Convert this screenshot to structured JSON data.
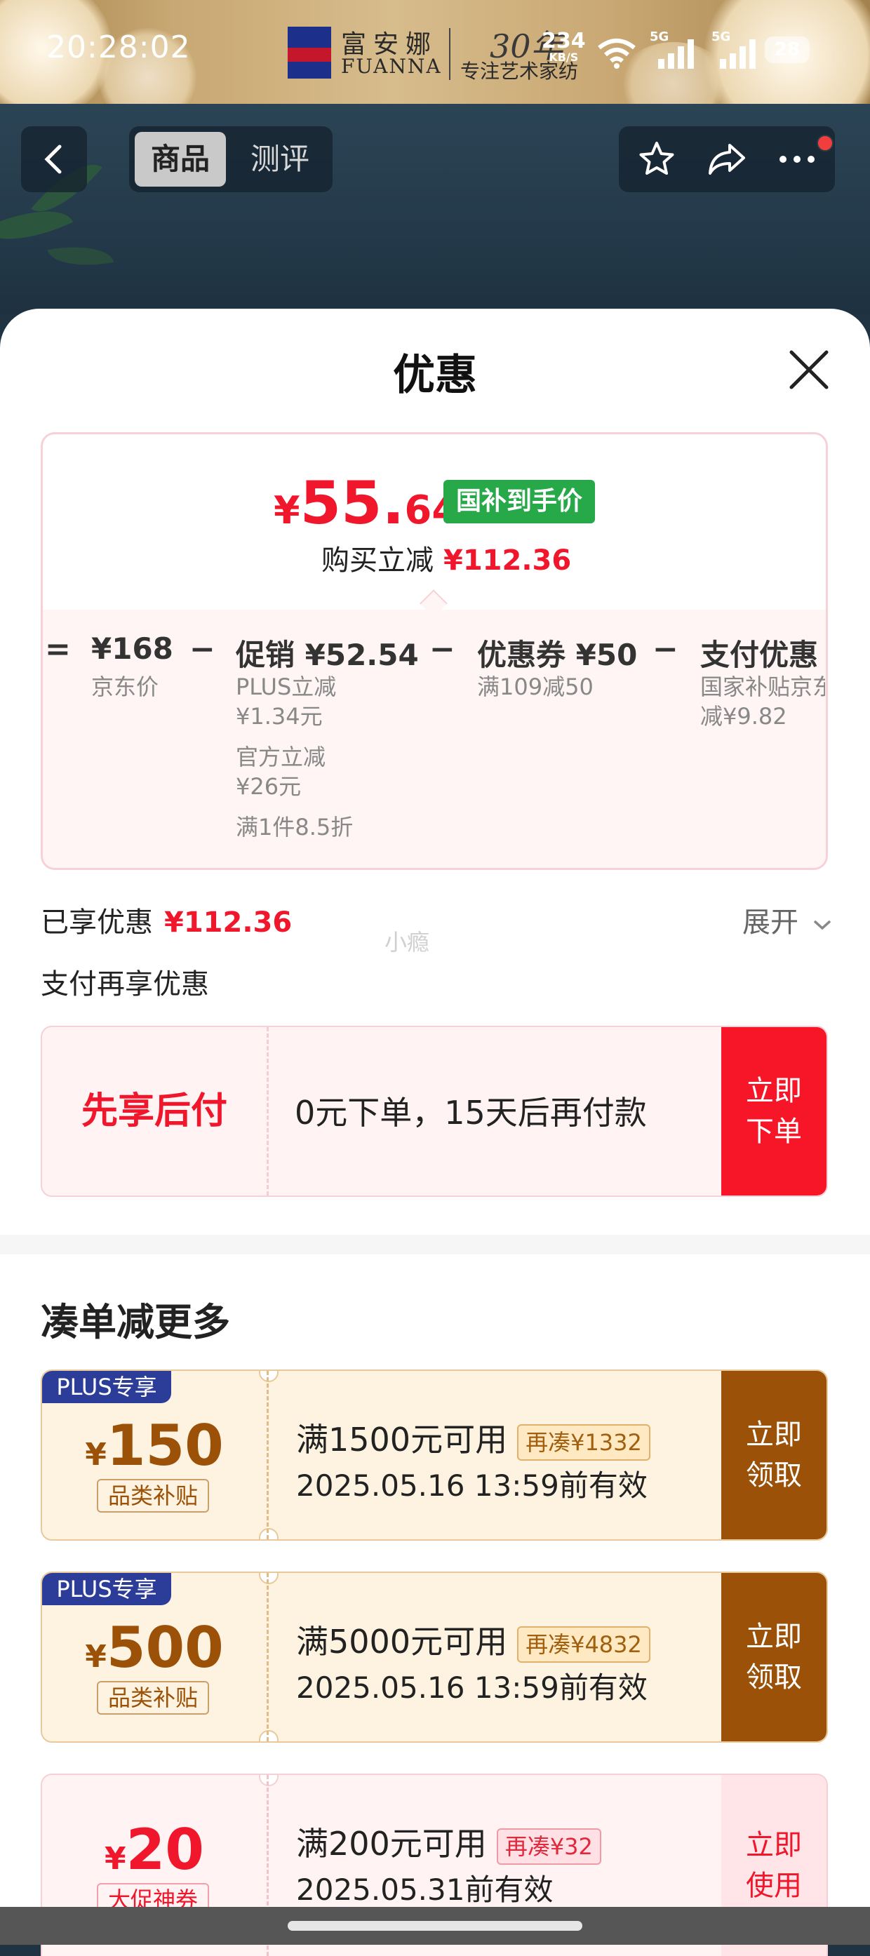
{
  "status_bar": {
    "time": "20:28:02",
    "brand_cn": "富安娜",
    "brand_en": "FUANNA",
    "brand_years": "30年",
    "brand_slogan": "专注艺术家纺",
    "net_speed": "234",
    "net_unit": "KB/S",
    "signal1_label": "5G",
    "signal2_label": "5G",
    "battery": "28"
  },
  "nav": {
    "tabs": [
      {
        "label": "商品",
        "active": true
      },
      {
        "label": "测评",
        "active": false
      }
    ],
    "icons": [
      "back-icon",
      "star-icon",
      "share-icon",
      "more-icon"
    ]
  },
  "sheet": {
    "title": "优惠"
  },
  "price_card": {
    "price_symbol": "¥",
    "price_int": "55.",
    "price_dec": "64",
    "price_badge": "国补到手价",
    "buy_reduce_label": "购买立减",
    "buy_reduce_value": "¥112.36",
    "breakdown": [
      {
        "op": "=",
        "main": "¥168",
        "subs": [
          "京东价"
        ]
      },
      {
        "op": "−",
        "main": "促销 ¥52.54",
        "subs": [
          "PLUS立减",
          "¥1.34元",
          "官方立减",
          "¥26元",
          "满1件8.5折"
        ]
      },
      {
        "op": "−",
        "main": "优惠券 ¥50",
        "subs": [
          "满109减50"
        ]
      },
      {
        "op": "−",
        "main": "支付优惠 ¥",
        "subs": [
          "国家补贴京东",
          "减¥9.82"
        ]
      }
    ]
  },
  "enjoyed": {
    "label": "已享优惠",
    "value": "¥112.36",
    "expand_label": "展开",
    "watermark": "小瘾"
  },
  "pay_more": {
    "label": "支付再享优惠",
    "card": {
      "left": "先享后付",
      "desc": "0元下单，15天后再付款",
      "button": "立即下单"
    }
  },
  "bundle": {
    "title": "凑单减更多",
    "coupons": [
      {
        "plus_tag": "PLUS专享",
        "symbol": "¥",
        "amount": "150",
        "category": "品类补贴",
        "condition": "满1500元可用",
        "extra": "再凑¥1332",
        "validity": "2025.05.16 13:59前有效",
        "button": "立即领取"
      },
      {
        "plus_tag": "PLUS专享",
        "symbol": "¥",
        "amount": "500",
        "category": "品类补贴",
        "condition": "满5000元可用",
        "extra": "再凑¥4832",
        "validity": "2025.05.16 13:59前有效",
        "button": "立即领取"
      },
      {
        "plus_tag": "",
        "symbol": "¥",
        "amount": "20",
        "category": "大促神券",
        "condition": "满200元可用",
        "extra": "再凑¥32",
        "validity": "2025.05.31前有效",
        "button": "立即使用"
      }
    ]
  },
  "colors": {
    "accent_red": "#f0172c",
    "green_badge": "#27a94a",
    "plus_blue": "#2b3d98",
    "gold_button": "#9b5208",
    "gold_bg": "#fef3e0"
  }
}
